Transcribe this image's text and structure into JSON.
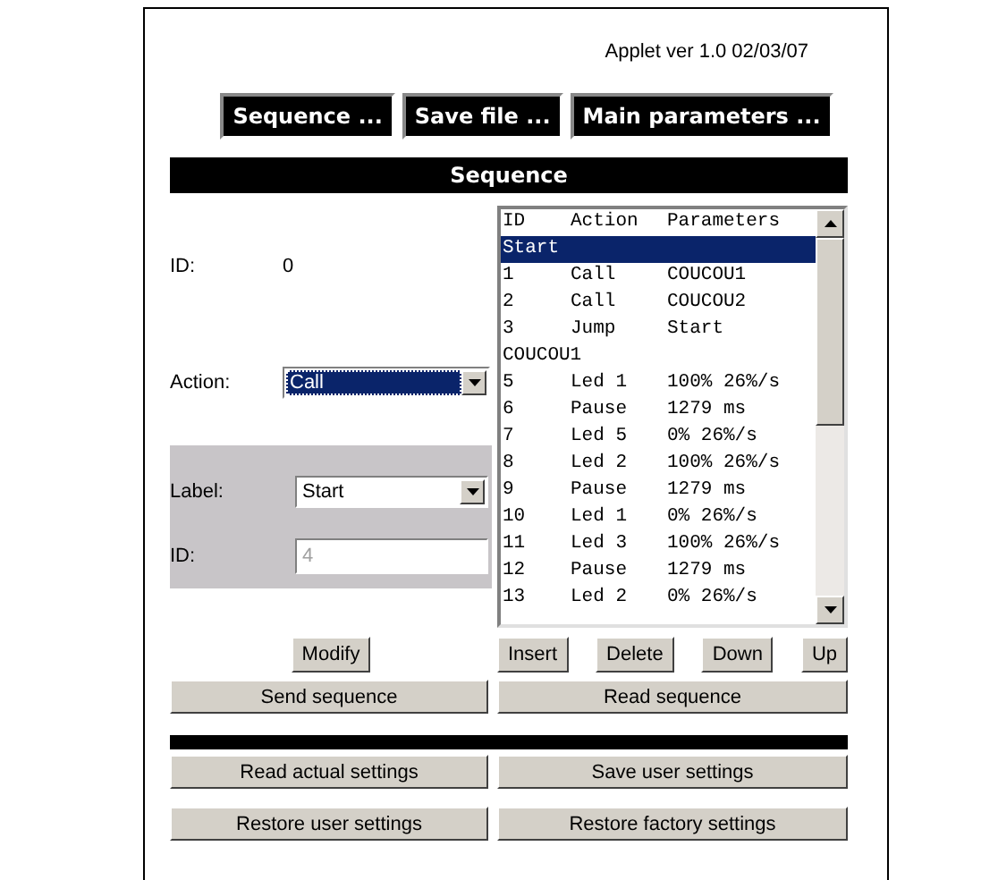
{
  "version": "Applet ver 1.0 02/03/07",
  "nav_buttons": [
    "Sequence ...",
    "Save file ...",
    "Main parameters ..."
  ],
  "section_title": "Sequence",
  "form": {
    "id_label": "ID:",
    "id_value": "0",
    "action_label": "Action:",
    "action_value": "Call",
    "label_label": "Label:",
    "label_value": "Start",
    "target_id_label": "ID:",
    "target_id_value": "4",
    "target_id_disabled": true,
    "modify": "Modify"
  },
  "list": {
    "columns": [
      "ID",
      "Action",
      "Parameters"
    ],
    "rows": [
      {
        "kind": "label",
        "text": "Start",
        "selected": true
      },
      {
        "kind": "step",
        "id": "1",
        "action": "Call",
        "params": "COUCOU1",
        "selected": false
      },
      {
        "kind": "step",
        "id": "2",
        "action": "Call",
        "params": "COUCOU2",
        "selected": false
      },
      {
        "kind": "step",
        "id": "3",
        "action": "Jump",
        "params": "Start",
        "selected": false
      },
      {
        "kind": "label",
        "text": "COUCOU1",
        "selected": false
      },
      {
        "kind": "step",
        "id": "5",
        "action": "Led 1",
        "params": "100% 26%/s",
        "selected": false
      },
      {
        "kind": "step",
        "id": "6",
        "action": "Pause",
        "params": "1279 ms",
        "selected": false
      },
      {
        "kind": "step",
        "id": "7",
        "action": "Led 5",
        "params": "0% 26%/s",
        "selected": false
      },
      {
        "kind": "step",
        "id": "8",
        "action": "Led 2",
        "params": "100% 26%/s",
        "selected": false
      },
      {
        "kind": "step",
        "id": "9",
        "action": "Pause",
        "params": "1279 ms",
        "selected": false
      },
      {
        "kind": "step",
        "id": "10",
        "action": "Led 1",
        "params": "0% 26%/s",
        "selected": false
      },
      {
        "kind": "step",
        "id": "11",
        "action": "Led 3",
        "params": "100% 26%/s",
        "selected": false
      },
      {
        "kind": "step",
        "id": "12",
        "action": "Pause",
        "params": "1279 ms",
        "selected": false
      },
      {
        "kind": "step",
        "id": "13",
        "action": "Led 2",
        "params": "0% 26%/s",
        "selected": false
      }
    ],
    "buttons": [
      "Insert",
      "Delete",
      "Down",
      "Up"
    ]
  },
  "sequence_buttons": [
    "Send sequence",
    "Read sequence"
  ],
  "settings_buttons": [
    "Read actual settings",
    "Save user settings",
    "Restore user settings",
    "Restore factory settings"
  ]
}
